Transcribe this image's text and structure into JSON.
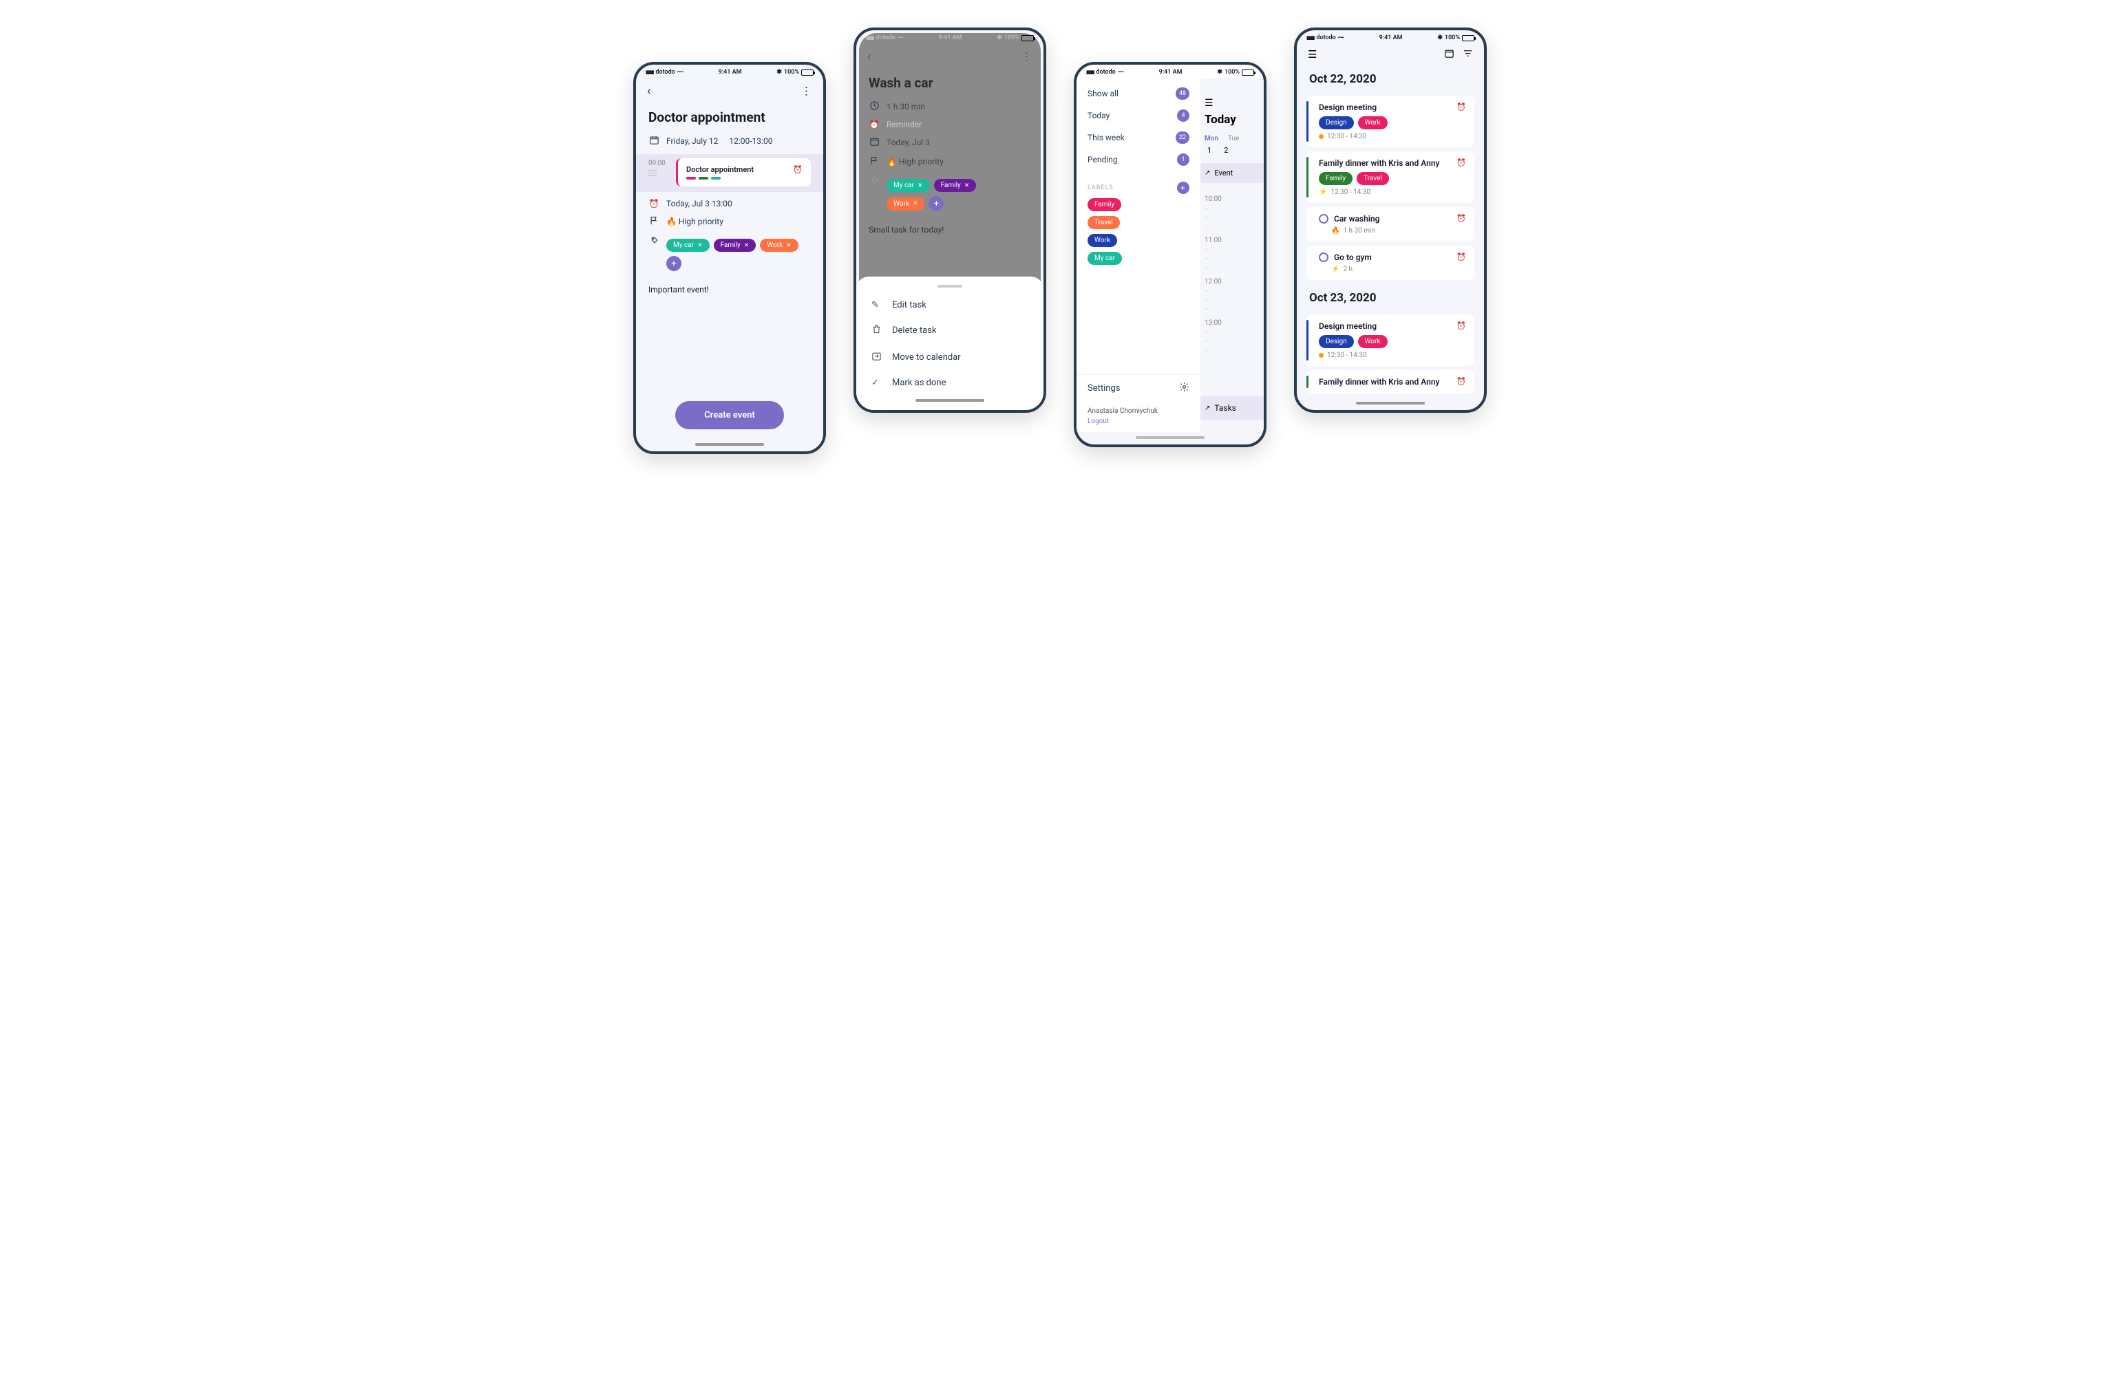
{
  "status": {
    "carrier": "dotodo",
    "time": "9:41 AM",
    "battery": "100%"
  },
  "colors": {
    "purple": "#7b6dc7",
    "pink": "#e91e63",
    "teal": "#1abc9c",
    "violet": "#6a1b9a",
    "orange": "#ff7043",
    "blue": "#1e40af",
    "green": "#2e7d32",
    "magenta": "#e91e63"
  },
  "screen1": {
    "title": "Doctor appointment",
    "date": "Friday, July 12",
    "time": "12:00-13:00",
    "timeline_hour": "09:00",
    "card_title": "Doctor appointment",
    "reminder": "Today, Jul 3   13:00",
    "priority": "🔥 High priority",
    "tags": [
      {
        "label": "My car",
        "color": "#1abc9c"
      },
      {
        "label": "Family",
        "color": "#6a1b9a"
      },
      {
        "label": "Work",
        "color": "#ff7043"
      }
    ],
    "note": "Important event!",
    "cta": "Create event"
  },
  "screen2": {
    "title": "Wash a car",
    "duration": "1 h 30 min",
    "reminder_placeholder": "Reminder",
    "date": "Today, Jul 3",
    "priority": "🔥 High priority",
    "tags": [
      {
        "label": "My car",
        "color": "#1abc9c"
      },
      {
        "label": "Family",
        "color": "#6a1b9a"
      },
      {
        "label": "Work",
        "color": "#ff7043"
      }
    ],
    "note": "Small task for today!",
    "sheet": {
      "edit": "Edit task",
      "delete": "Delete task",
      "move": "Move to calendar",
      "done": "Mark as done"
    }
  },
  "screen3": {
    "filters": [
      {
        "label": "Show all",
        "count": "48"
      },
      {
        "label": "Today",
        "count": "4"
      },
      {
        "label": "This week",
        "count": "22"
      },
      {
        "label": "Pending",
        "count": "1"
      }
    ],
    "labels_header": "LABELS",
    "labels": [
      {
        "label": "Family",
        "color": "#e91e63"
      },
      {
        "label": "Travel",
        "color": "#ff7043"
      },
      {
        "label": "Work",
        "color": "#1e40af"
      },
      {
        "label": "My car",
        "color": "#1abc9c"
      }
    ],
    "settings": "Settings",
    "user": "Anastasia Chorniychuk",
    "logout": "Logout",
    "main": {
      "title": "Today",
      "days": [
        "Mon",
        "Tue"
      ],
      "nums": [
        "1",
        "2"
      ],
      "event_label": "Event",
      "hours": [
        "10:00",
        "11:00",
        "12:00",
        "13:00"
      ],
      "tasks_tab": "Tasks"
    }
  },
  "screen4": {
    "sections": [
      {
        "date": "Oct 22, 2020",
        "items": [
          {
            "type": "event",
            "color": "#1e40af",
            "title": "Design meeting",
            "tags": [
              {
                "label": "Design",
                "color": "#1e40af"
              },
              {
                "label": "Work",
                "color": "#e91e63"
              }
            ],
            "time": "12:30 - 14:30",
            "icon": "dot"
          },
          {
            "type": "event",
            "color": "#2e7d32",
            "title": "Family dinner with Kris and Anny",
            "tags": [
              {
                "label": "Family",
                "color": "#2e7d32"
              },
              {
                "label": "Travel",
                "color": "#e91e63"
              }
            ],
            "time": "12:30 - 14:30",
            "icon": "bolt"
          },
          {
            "type": "task",
            "title": "Car washing",
            "meta": "1 h 30 min",
            "icon": "fire"
          },
          {
            "type": "task",
            "title": "Go to gym",
            "meta": "2 h",
            "icon": "bolt"
          }
        ]
      },
      {
        "date": "Oct 23, 2020",
        "items": [
          {
            "type": "event",
            "color": "#1e40af",
            "title": "Design meeting",
            "tags": [
              {
                "label": "Design",
                "color": "#1e40af"
              },
              {
                "label": "Work",
                "color": "#e91e63"
              }
            ],
            "time": "12:30 - 14:30",
            "icon": "dot"
          },
          {
            "type": "event",
            "color": "#2e7d32",
            "title": "Family dinner with Kris and Anny"
          }
        ]
      }
    ]
  }
}
